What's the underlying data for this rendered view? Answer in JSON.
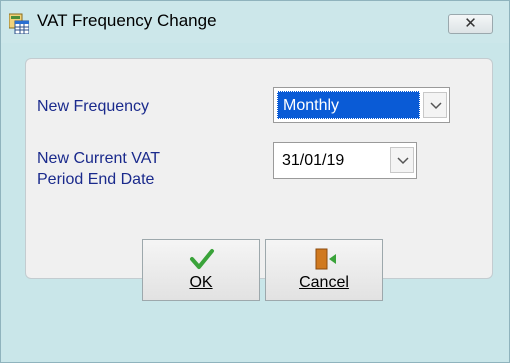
{
  "window": {
    "title": "VAT Frequency Change",
    "close_glyph": "✕",
    "icon": "vat-table-icon"
  },
  "form": {
    "frequency_label": "New Frequency",
    "frequency_value": "Monthly",
    "date_label": "New Current VAT Period End Date",
    "date_value": "31/01/19"
  },
  "buttons": {
    "ok_label": "OK",
    "ok_icon": "checkmark-icon",
    "cancel_label": "Cancel",
    "cancel_icon": "exit-door-icon"
  },
  "colors": {
    "window_bg": "#c9e6e9",
    "label_text": "#1a2a8c",
    "selection": "#0a5bd6",
    "ok_check": "#3aa33a",
    "cancel_door": "#d0791f"
  }
}
